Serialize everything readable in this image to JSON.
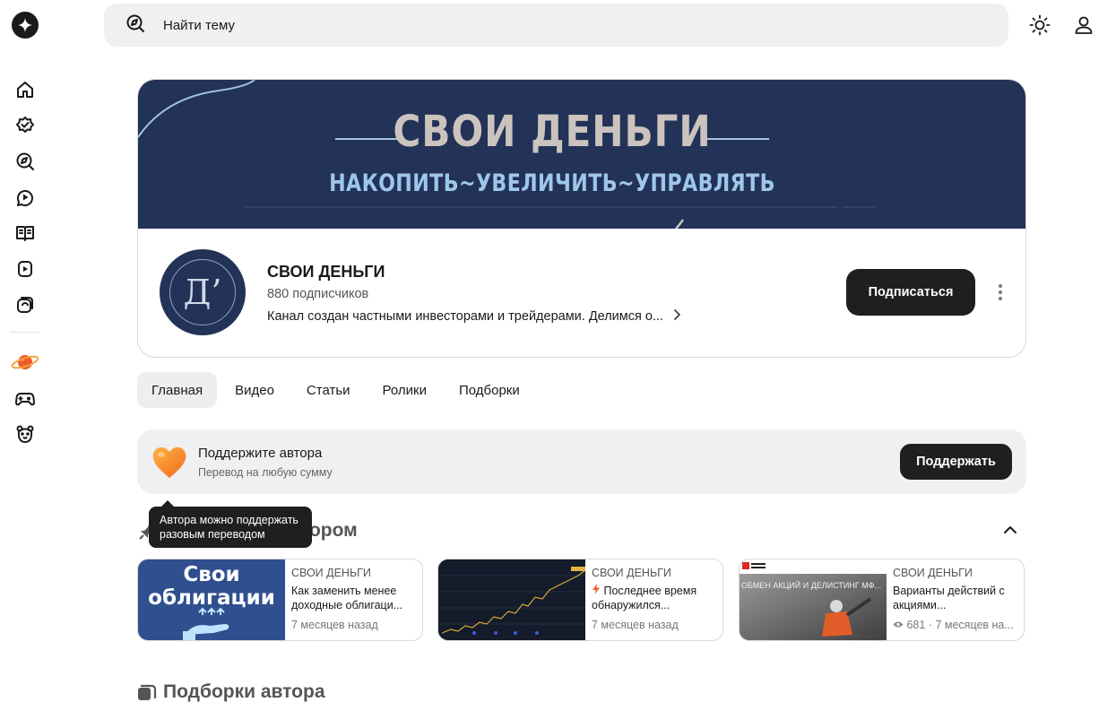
{
  "search": {
    "placeholder": "Найти тему"
  },
  "channel": {
    "banner_title": "СВОИ ДЕНЬГИ",
    "banner_subtitle": "НАКОПИТЬ~УВЕЛИЧИТЬ~УПРАВЛЯТЬ",
    "avatar_letter": "Д’",
    "name": "СВОИ ДЕНЬГИ",
    "subscribers": "880 подписчиков",
    "description": "Канал создан частными инвесторами и трейдерами. Делимся о...",
    "subscribe_label": "Подписаться"
  },
  "tabs": [
    {
      "label": "Главная",
      "active": true
    },
    {
      "label": "Видео",
      "active": false
    },
    {
      "label": "Статьи",
      "active": false
    },
    {
      "label": "Ролики",
      "active": false
    },
    {
      "label": "Подборки",
      "active": false
    }
  ],
  "support": {
    "title": "Поддержите автора",
    "subtitle": "Перевод на любую сумму",
    "button": "Поддержать",
    "tooltip": "Автора можно поддержать разовым переводом"
  },
  "pinned": {
    "title": "Закреплено автором",
    "cards": [
      {
        "author": "СВОИ ДЕНЬГИ",
        "title": "Как заменить менее доходные облигаци...",
        "date": "7 месяцев назад",
        "thumb_text": "Свои облигации"
      },
      {
        "author": "СВОИ ДЕНЬГИ",
        "title": "Последнее время обнаружился...",
        "date": "7 месяцев назад"
      },
      {
        "author": "СВОИ ДЕНЬГИ",
        "title": "Варианты действий с акциями...",
        "date": "681 · 7 месяцев на...",
        "thumb_text": "ОБМЕН АКЦИЙ И ДЕЛИСТИНГ МФ..."
      }
    ]
  },
  "collections": {
    "title": "Подборки автора"
  },
  "colors": {
    "banner": "#233257",
    "accent_dark": "#1f1f1f",
    "surface": "#eef0f2"
  }
}
